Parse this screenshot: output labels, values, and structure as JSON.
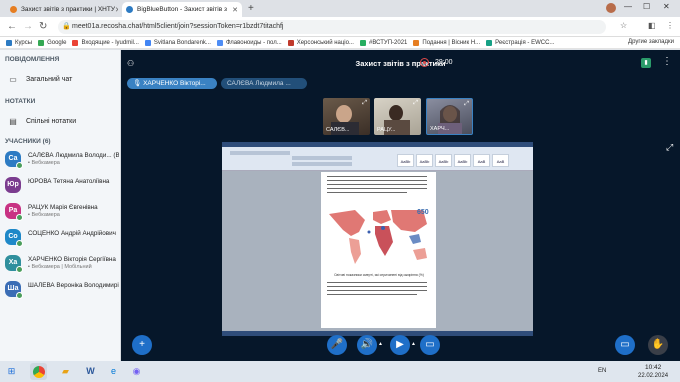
{
  "browser": {
    "tabs": [
      {
        "title": "Захист звітів з практики | ХНТУ",
        "active": false
      },
      {
        "title": "BigBlueButton - Захист звітів з",
        "active": true
      }
    ],
    "url": "meet01a.recosha.chat/html5client/join?sessionToken=r1bzdt7titachfj",
    "bookmarks": [
      "Курсы",
      "Google",
      "Входящие - lyudmil...",
      "Svitlana Bondarenk...",
      "Флавоноиды - пол...",
      "Херсонський націо...",
      "#ВСТУП-2021",
      "Подання | Вісник Н...",
      "Реєстрація - EWCC..."
    ],
    "other_bookmarks": "Другие закладки"
  },
  "sidebar": {
    "messages_title": "ПОВІДОМЛЕННЯ",
    "public_chat": "Загальний чат",
    "notes_title": "НОТАТКИ",
    "shared_notes": "Спільні нотатки",
    "participants_title": "УЧАСНИКИ (6)",
    "users": [
      {
        "initials": "Са",
        "name": "САЛЄВА Людмила Володи... (Ви)",
        "sub": "Вебкамера",
        "color": "#2d7bc3"
      },
      {
        "initials": "Юр",
        "name": "ЮРОВА Тетяна Анатоліївна",
        "sub": "",
        "color": "#7b3c8f"
      },
      {
        "initials": "Ра",
        "name": "РАЦУК Марія Євгенівна",
        "sub": "Вебкамера",
        "color": "#c83283"
      },
      {
        "initials": "Со",
        "name": "СОЦЕНКО Андрій Андрійович",
        "sub": "",
        "color": "#1e88c8"
      },
      {
        "initials": "Ха",
        "name": "ХАРЧЕНКО Вікторія Сергіївна",
        "sub": "Вебкамера | Мобільний",
        "color": "#2f8f9d"
      },
      {
        "initials": "Ша",
        "name": "ШАЛЕВА Вероніка Володимирі...",
        "sub": "",
        "color": "#3b6db5"
      }
    ]
  },
  "meeting": {
    "title": "Захист звітів з практики",
    "timer": "29:00",
    "talkers": [
      "ХАРЧЕНКО Вікторі...",
      "САЛЄВА Людмила ..."
    ],
    "cameras": [
      "САЛЄВ...",
      "РАЦУ...",
      "ХАРЧ..."
    ]
  },
  "document": {
    "chart_number": "650",
    "caption": "Світові показники смерті, які спричинені від ожиріння (%)"
  },
  "taskbar": {
    "lang": "EN",
    "time": "10:42",
    "date": "22.02.2024"
  },
  "colors": {
    "accent": "#1f6fc8",
    "main_bg": "#06172a",
    "record": "#e04a4a"
  }
}
